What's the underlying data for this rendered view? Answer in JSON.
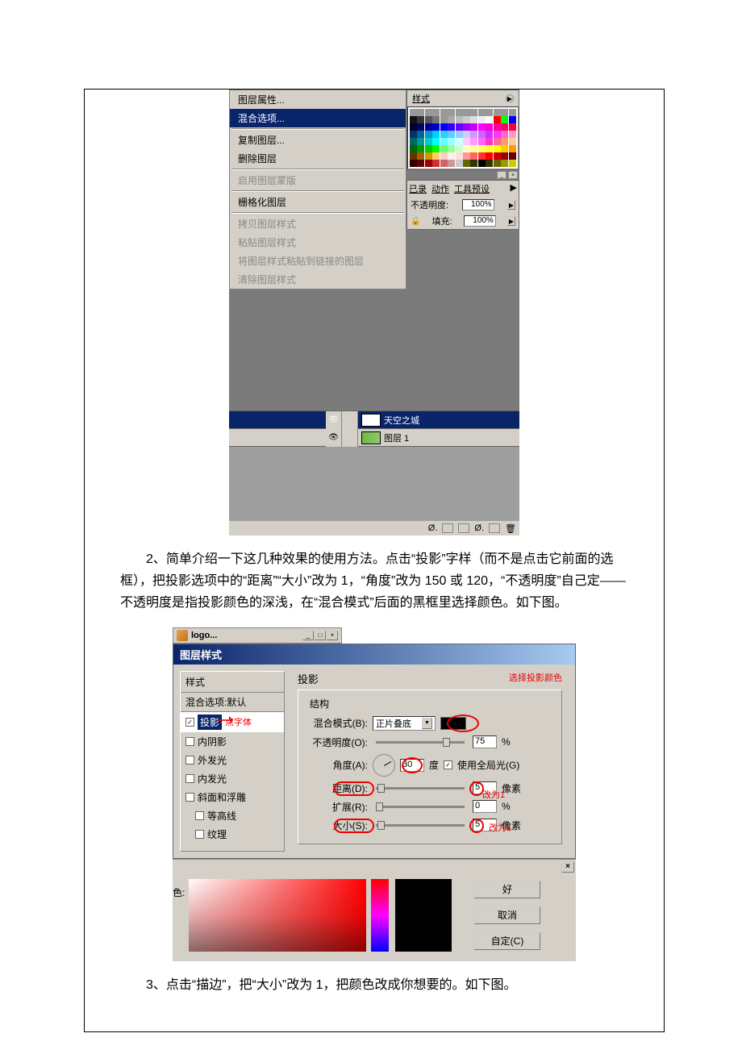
{
  "context_menu": {
    "item_properties": "图层属性...",
    "item_blend_options": "混合选项...",
    "item_duplicate": "复制图层...",
    "item_delete": "删除图层",
    "item_enable_mask": "启用图层蒙版",
    "item_rasterize": "栅格化图层",
    "item_copy_style": "拷贝图层样式",
    "item_paste_style": "粘贴图层样式",
    "item_paste_linked": "将图层样式粘贴到链接的图层",
    "item_clear_style": "清除图层样式"
  },
  "swatch_panel": {
    "tab": "样式",
    "colors": [
      "#999",
      "#999",
      "#999",
      "#999",
      "#999",
      "#999",
      "#999",
      "#999",
      "#999",
      "#999",
      "#999",
      "#999",
      "#999",
      "#999",
      "#111",
      "#333",
      "#555",
      "#777",
      "#999",
      "#aaa",
      "#bbb",
      "#ccc",
      "#ddd",
      "#eee",
      "#fff",
      "#f00",
      "#0f0",
      "#00f",
      "#003",
      "#006",
      "#009",
      "#00c",
      "#00f",
      "#30f",
      "#60f",
      "#90f",
      "#c0f",
      "#f0f",
      "#f0c",
      "#f09",
      "#f06",
      "#f03",
      "#036",
      "#069",
      "#09c",
      "#0cf",
      "#3cf",
      "#6cf",
      "#9cf",
      "#ccf",
      "#c9f",
      "#c6f",
      "#c3f",
      "#f3f",
      "#f6c",
      "#f9c",
      "#066",
      "#099",
      "#0cc",
      "#0ff",
      "#6ff",
      "#9ff",
      "#cff",
      "#fcf",
      "#f9f",
      "#f6f",
      "#f3c",
      "#f69",
      "#f96",
      "#fc9",
      "#060",
      "#090",
      "#0c0",
      "#0f0",
      "#6f6",
      "#9f9",
      "#cfc",
      "#ffc",
      "#ff9",
      "#ff6",
      "#ff3",
      "#ff0",
      "#fc0",
      "#f90",
      "#630",
      "#960",
      "#c90",
      "#fc6",
      "#fcc",
      "#fee",
      "#fdd",
      "#f99",
      "#f66",
      "#f33",
      "#f00",
      "#c00",
      "#900",
      "#600",
      "#300",
      "#600",
      "#900",
      "#c33",
      "#c66",
      "#c99",
      "#ccc",
      "#660",
      "#330",
      "#000",
      "#330",
      "#660",
      "#990",
      "#cc0"
    ]
  },
  "layers_panel": {
    "tab_history": "已录",
    "tab_actions": "动作",
    "tab_preset": "工具预设",
    "opacity_label": "不透明度:",
    "opacity_value": "100%",
    "fill_label": "填充:",
    "fill_value": "100%",
    "layer_sky": "天空之城",
    "layer_sky_thumb": "T",
    "layer_1": "图层 1"
  },
  "paragraph_2": "2、简单介绍一下这几种效果的使用方法。点击“投影”字样（而不是点击它前面的选框），把投影选项中的“距离”“大小”改为 1，“角度”改为 150 或 120，“不透明度”自己定——不透明度是指投影颜色的深浅，在“混合模式”后面的黑框里选择颜色。如下图。",
  "layer_style": {
    "window_title": "logo...",
    "dialog_title": "图层样式",
    "sidebar_header": "样式",
    "blend_default": "混合选项:默认",
    "shadow_prefix": "投影",
    "inner_shadow": "内阴影",
    "outer_glow": "外发光",
    "inner_glow": "内发光",
    "bevel": "斜面和浮雕",
    "contour": "等高线",
    "texture": "纹理",
    "anno_click_text": "点字体",
    "main_title": "投影",
    "structure_label": "结构",
    "blend_mode_label": "混合模式(B):",
    "blend_mode_value": "正片叠底",
    "anno_select_color": "选择投影颜色",
    "opacity_label": "不透明度(O):",
    "opacity_value": "75",
    "opacity_unit": "%",
    "angle_label": "角度(A):",
    "angle_value": "30",
    "angle_unit": "度",
    "use_global_label": "使用全局光(G)",
    "distance_label": "距离(D):",
    "distance_value": "5",
    "distance_unit": "像素",
    "anno_change1": "改为1",
    "spread_label": "扩展(R):",
    "spread_value": "0",
    "spread_unit": "%",
    "size_label": "大小(S):",
    "size_value": "5",
    "size_unit": "像素",
    "anno_change1b": "改为1"
  },
  "picker": {
    "label": "色:",
    "btn_ok": "好",
    "btn_cancel": "取消",
    "btn_custom": "自定(C)"
  },
  "paragraph_3": "3、点击“描边”，把“大小”改为 1，把颜色改成你想要的。如下图。"
}
